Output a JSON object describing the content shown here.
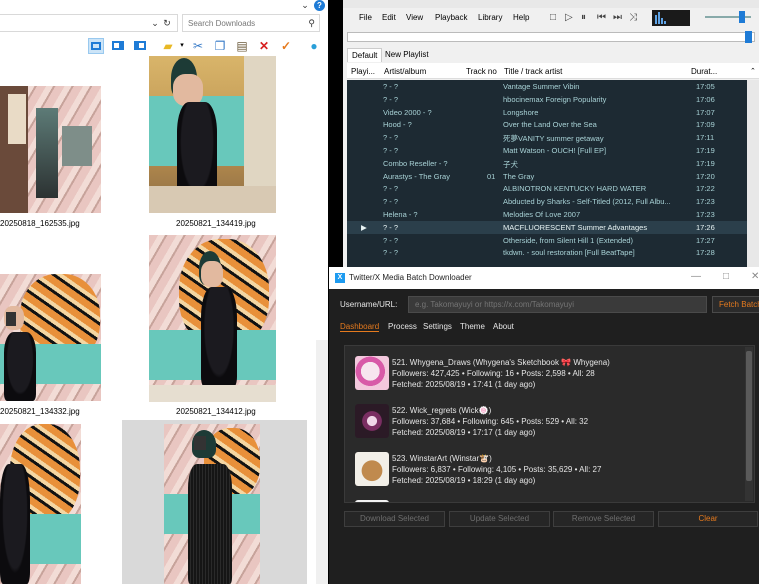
{
  "explorer": {
    "search_placeholder": "Search Downloads",
    "help_icon_text": "?",
    "thumbnails": [
      {
        "label": "20250818_162535.jpg"
      },
      {
        "label": "20250821_134419.jpg"
      },
      {
        "label": "20250821_134332.jpg"
      },
      {
        "label": "20250821_134412.jpg"
      },
      {
        "label": ""
      },
      {
        "label": ""
      }
    ]
  },
  "player": {
    "menu": [
      "File",
      "Edit",
      "View",
      "Playback",
      "Library",
      "Help"
    ],
    "tabs": [
      "Default",
      "New Playlist"
    ],
    "columns": [
      "Playi...",
      "Artist/album",
      "Track no",
      "Title / track artist",
      "Durat..."
    ],
    "rows": [
      {
        "playing": "",
        "artist": "? - ?",
        "track": "",
        "title": "Vantage  Summer Vibin",
        "duration": "17:05"
      },
      {
        "playing": "",
        "artist": "? - ?",
        "track": "",
        "title": "hbocinemax  Foreign Popularity",
        "duration": "17:06"
      },
      {
        "playing": "",
        "artist": "Video 2000 - ?",
        "track": "",
        "title": "Longshore",
        "duration": "17:07"
      },
      {
        "playing": "",
        "artist": "Hood - ?",
        "track": "",
        "title": "Over the Land Over the Sea",
        "duration": "17:09"
      },
      {
        "playing": "",
        "artist": "? - ?",
        "track": "",
        "title": "死夢VANITY  summer getaway",
        "duration": "17:11"
      },
      {
        "playing": "",
        "artist": "? - ?",
        "track": "",
        "title": "Matt Watson - OUCH! [Full EP]",
        "duration": "17:19"
      },
      {
        "playing": "",
        "artist": "Combo Reseller - ?",
        "track": "",
        "title": "子犬",
        "duration": "17:19"
      },
      {
        "playing": "",
        "artist": "Aurastys - The Gray",
        "track": "01",
        "title": "The Gray",
        "duration": "17:20"
      },
      {
        "playing": "",
        "artist": "? - ?",
        "track": "",
        "title": "ALBINOTRON  KENTUCKY HARD WATER",
        "duration": "17:22"
      },
      {
        "playing": "",
        "artist": "? - ?",
        "track": "",
        "title": "Abducted by Sharks - Self-Titled (2012, Full Albu...",
        "duration": "17:23"
      },
      {
        "playing": "",
        "artist": "Helena - ?",
        "track": "",
        "title": "Melodies Of Love 2007",
        "duration": "17:23"
      },
      {
        "playing": "▶",
        "artist": "? - ?",
        "track": "",
        "title": "MACFLUORESCENT  Summer Advantages",
        "duration": "17:26"
      },
      {
        "playing": "",
        "artist": "? - ?",
        "track": "",
        "title": "Otherside, from Silent Hill 1 (Extended)",
        "duration": "17:27"
      },
      {
        "playing": "",
        "artist": "? - ?",
        "track": "",
        "title": "tkdwn. - soul restoration [Full BeatTape]",
        "duration": "17:28"
      }
    ]
  },
  "downloader": {
    "title": "Twitter/X Media Batch Downloader",
    "username_label": "Username/URL:",
    "input_placeholder": "e.g. Takomayuyi or https://x.com/Takomayuyi",
    "fetch_label": "Fetch Batch",
    "tabs": [
      "Dashboard",
      "Process",
      "Settings",
      "Theme",
      "About"
    ],
    "accounts": [
      {
        "line1": "521. Whygena_Draws (Whygena's Sketchbook 🎀 Whygena)",
        "line2": "Followers: 427,425 • Following: 16 • Posts: 2,598 • All: 28",
        "line3": "Fetched: 2025/08/19 • 17:41 (1 day ago)"
      },
      {
        "line1": "522. Wick_regrets (Wick🍥)",
        "line2": "Followers: 37,684 • Following: 645 • Posts: 529 • All: 32",
        "line3": "Fetched: 2025/08/19 • 17:17 (1 day ago)"
      },
      {
        "line1": "523. WinstarArt (Winstar🐮)",
        "line2": "Followers: 6,837 • Following: 4,105 • Posts: 35,629 • All: 27",
        "line3": "Fetched: 2025/08/19 • 18:29 (1 day ago)"
      }
    ],
    "buttons": {
      "download": "Download Selected",
      "update": "Update Selected",
      "remove": "Remove Selected",
      "clear": "Clear"
    },
    "colors": {
      "accent": "#e57a1e",
      "background": "#1f1f1f"
    }
  }
}
